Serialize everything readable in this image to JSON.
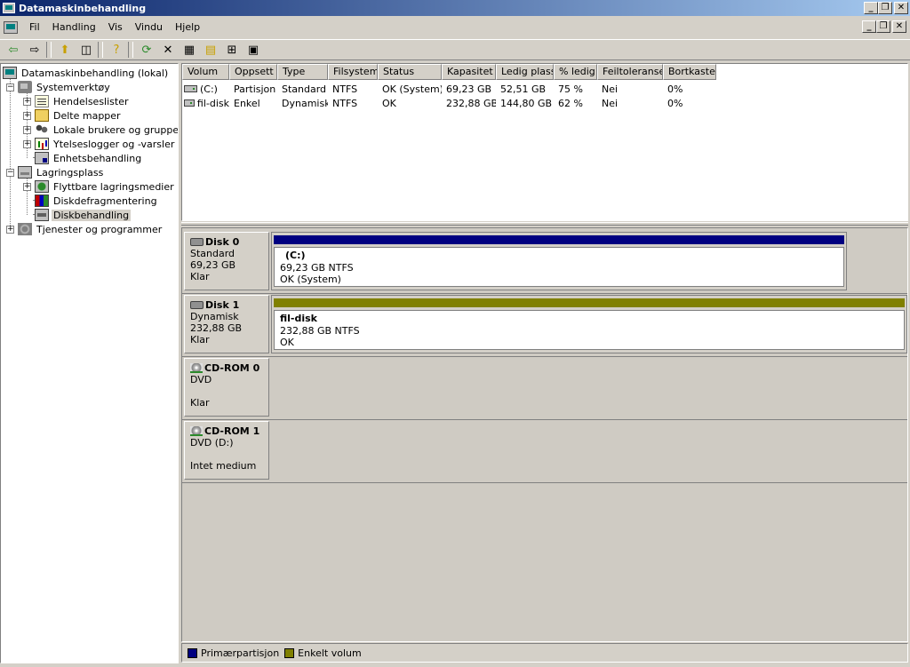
{
  "window": {
    "title": "Datamaskinbehandling",
    "min_symbol": "_",
    "restore_symbol": "❐",
    "close_symbol": "✕"
  },
  "menu": {
    "items": [
      "Fil",
      "Handling",
      "Vis",
      "Vindu",
      "Hjelp"
    ]
  },
  "toolbar": {
    "back": "⇦",
    "forward": "⇨",
    "up": "⬆",
    "showhide": "◫",
    "properties_sheet": "?",
    "refresh": "⟳",
    "delete": "✕",
    "properties": "▦",
    "open": "▤",
    "help": "⊞",
    "export": "▣"
  },
  "tree": {
    "items": [
      {
        "label": "Datamaskinbehandling (lokal)",
        "icon": "computer-icon"
      },
      {
        "label": "Systemverktøy",
        "icon": "tools-icon",
        "expander": "−"
      },
      {
        "label": "Hendelseslister",
        "icon": "event-log-icon",
        "expander": "+"
      },
      {
        "label": "Delte mapper",
        "icon": "folder-icon",
        "expander": "+"
      },
      {
        "label": "Lokale brukere og grupper",
        "icon": "users-icon",
        "expander": "+"
      },
      {
        "label": "Ytelseslogger og -varsler",
        "icon": "performance-icon",
        "expander": "+"
      },
      {
        "label": "Enhetsbehandling",
        "icon": "device-manager-icon"
      },
      {
        "label": "Lagringsplass",
        "icon": "storage-icon",
        "expander": "−"
      },
      {
        "label": "Flyttbare lagringsmedier",
        "icon": "removable-storage-icon",
        "expander": "+"
      },
      {
        "label": "Diskdefragmentering",
        "icon": "defrag-icon"
      },
      {
        "label": "Diskbehandling",
        "icon": "disk-management-icon",
        "selected": true
      },
      {
        "label": "Tjenester og programmer",
        "icon": "services-icon",
        "expander": "+"
      }
    ]
  },
  "volumes": {
    "columns": [
      "Volum",
      "Oppsett",
      "Type",
      "Filsystem",
      "Status",
      "Kapasitet",
      "Ledig plass",
      "% ledig",
      "Feiltoleranse",
      "Bortkastet"
    ],
    "rows": [
      [
        "(C:)",
        "Partisjon",
        "Standard",
        "NTFS",
        "OK (System)",
        "69,23 GB",
        "52,51 GB",
        "75 %",
        "Nei",
        "0%"
      ],
      [
        "fil-disk",
        "Enkel",
        "Dynamisk",
        "NTFS",
        "OK",
        "232,88 GB",
        "144,80 GB",
        "62 %",
        "Nei",
        "0%"
      ]
    ]
  },
  "disks": {
    "disk0": {
      "name": "Disk 0",
      "type": "Standard",
      "size": "69,23 GB",
      "state": "Klar",
      "partition": {
        "name": "(C:)",
        "size": "69,23 GB NTFS",
        "status": "OK (System)",
        "color": "#000080"
      }
    },
    "disk1": {
      "name": "Disk 1",
      "type": "Dynamisk",
      "size": "232,88 GB",
      "state": "Klar",
      "partition": {
        "name": "fil-disk",
        "size": "232,88 GB NTFS",
        "status": "OK",
        "color": "#808000"
      }
    },
    "cdrom0": {
      "name": "CD-ROM 0",
      "type": "DVD",
      "state": "Klar"
    },
    "cdrom1": {
      "name": "CD-ROM 1",
      "type": "DVD (D:)",
      "state": "Intet medium"
    }
  },
  "legend": {
    "primary": {
      "label": "Primærpartisjon",
      "color": "#000080"
    },
    "simple": {
      "label": "Enkelt volum",
      "color": "#808000"
    }
  }
}
